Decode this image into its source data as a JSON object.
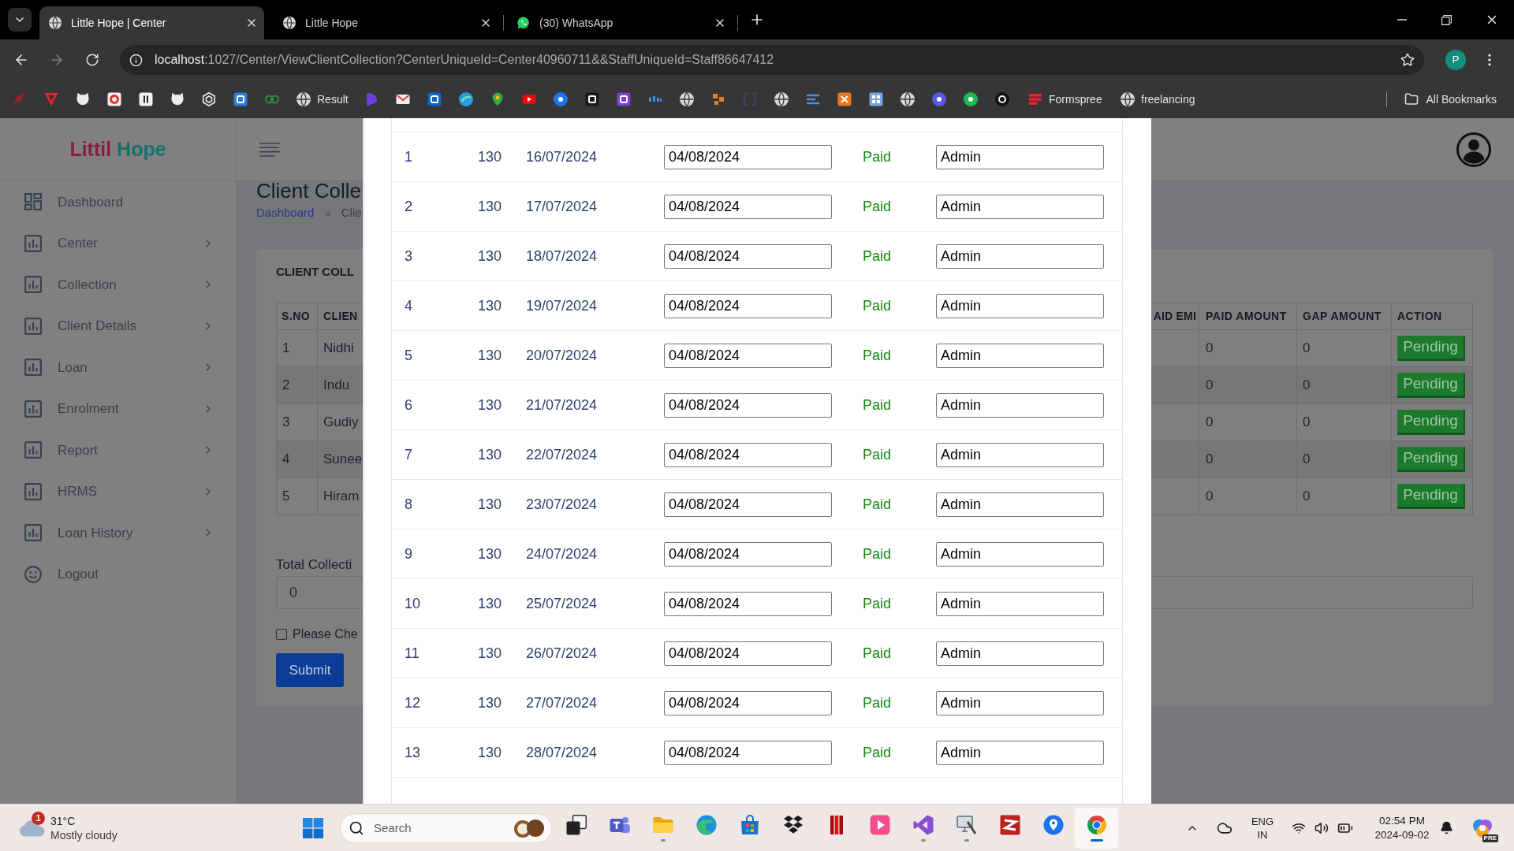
{
  "browser": {
    "tabs": [
      {
        "title": "Little Hope | Center",
        "kind": "site",
        "selected": true
      },
      {
        "title": "Little Hope",
        "kind": "site",
        "selected": false
      },
      {
        "title": "(30) WhatsApp",
        "kind": "chat",
        "selected": false
      }
    ],
    "forward_disabled": true,
    "address": {
      "host": "localhost",
      "rest": ":1027/Center/ViewClientCollection?CenterUniqueId=Center40960711&&StaffUniqueId=Staff86647412"
    },
    "profile_initial": "P",
    "bookmarks": [
      {
        "label": "Result"
      },
      {
        "label": "Formspree"
      },
      {
        "label": "freelancing"
      }
    ],
    "all_bookmarks": "All Bookmarks"
  },
  "app": {
    "logo": {
      "first": "Littil",
      "second": "Hope"
    },
    "sidebar": [
      {
        "label": "Dashboard",
        "kind": "dashboard",
        "expandable": false
      },
      {
        "label": "Center",
        "kind": "chart",
        "expandable": true
      },
      {
        "label": "Collection",
        "kind": "chart",
        "expandable": true
      },
      {
        "label": "Client Details",
        "kind": "chart",
        "expandable": true
      },
      {
        "label": "Loan",
        "kind": "chart",
        "expandable": true
      },
      {
        "label": "Enrolment",
        "kind": "chart",
        "expandable": true
      },
      {
        "label": "Report",
        "kind": "chart",
        "expandable": true
      },
      {
        "label": "HRMS",
        "kind": "chart",
        "expandable": true
      },
      {
        "label": "Loan History",
        "kind": "chart",
        "expandable": true
      },
      {
        "label": "Logout",
        "kind": "logout",
        "expandable": false
      }
    ],
    "page_title": "Client Colle",
    "breadcrumb": [
      {
        "label": "Dashboard",
        "kind": "link"
      },
      {
        "label": "»",
        "kind": "separator"
      },
      {
        "label": "Clie",
        "kind": "current"
      }
    ],
    "card_title": "CLIENT COLL",
    "table": {
      "columns": [
        "S.NO",
        "CLIEN",
        "AID EMI",
        "PAID AMOUNT",
        "GAP AMOUNT",
        "ACTION"
      ],
      "rows": [
        {
          "sno": "1",
          "client": "Nidhi",
          "paid_amount": "0",
          "gap_amount": "0",
          "action": "Pending"
        },
        {
          "sno": "2",
          "client": "Indu",
          "paid_amount": "0",
          "gap_amount": "0",
          "action": "Pending"
        },
        {
          "sno": "3",
          "client": "Gudiy",
          "paid_amount": "0",
          "gap_amount": "0",
          "action": "Pending"
        },
        {
          "sno": "4",
          "client": "Sunee",
          "paid_amount": "0",
          "gap_amount": "0",
          "action": "Pending"
        },
        {
          "sno": "5",
          "client": "Hiram",
          "paid_amount": "0",
          "gap_amount": "0",
          "action": "Pending"
        }
      ]
    },
    "total": {
      "label": "Total Collecti",
      "value": "0"
    },
    "confirm": {
      "label": "Please Che",
      "checked": false
    },
    "submit": "Submit"
  },
  "modal": {
    "rows": [
      {
        "sno": "1",
        "amount": "130",
        "due_date": "16/07/2024",
        "paid_date": "04/08/2024",
        "status": "Paid",
        "collected_by": "Admin"
      },
      {
        "sno": "2",
        "amount": "130",
        "due_date": "17/07/2024",
        "paid_date": "04/08/2024",
        "status": "Paid",
        "collected_by": "Admin"
      },
      {
        "sno": "3",
        "amount": "130",
        "due_date": "18/07/2024",
        "paid_date": "04/08/2024",
        "status": "Paid",
        "collected_by": "Admin"
      },
      {
        "sno": "4",
        "amount": "130",
        "due_date": "19/07/2024",
        "paid_date": "04/08/2024",
        "status": "Paid",
        "collected_by": "Admin"
      },
      {
        "sno": "5",
        "amount": "130",
        "due_date": "20/07/2024",
        "paid_date": "04/08/2024",
        "status": "Paid",
        "collected_by": "Admin"
      },
      {
        "sno": "6",
        "amount": "130",
        "due_date": "21/07/2024",
        "paid_date": "04/08/2024",
        "status": "Paid",
        "collected_by": "Admin"
      },
      {
        "sno": "7",
        "amount": "130",
        "due_date": "22/07/2024",
        "paid_date": "04/08/2024",
        "status": "Paid",
        "collected_by": "Admin"
      },
      {
        "sno": "8",
        "amount": "130",
        "due_date": "23/07/2024",
        "paid_date": "04/08/2024",
        "status": "Paid",
        "collected_by": "Admin"
      },
      {
        "sno": "9",
        "amount": "130",
        "due_date": "24/07/2024",
        "paid_date": "04/08/2024",
        "status": "Paid",
        "collected_by": "Admin"
      },
      {
        "sno": "10",
        "amount": "130",
        "due_date": "25/07/2024",
        "paid_date": "04/08/2024",
        "status": "Paid",
        "collected_by": "Admin"
      },
      {
        "sno": "11",
        "amount": "130",
        "due_date": "26/07/2024",
        "paid_date": "04/08/2024",
        "status": "Paid",
        "collected_by": "Admin"
      },
      {
        "sno": "12",
        "amount": "130",
        "due_date": "27/07/2024",
        "paid_date": "04/08/2024",
        "status": "Paid",
        "collected_by": "Admin"
      },
      {
        "sno": "13",
        "amount": "130",
        "due_date": "28/07/2024",
        "paid_date": "04/08/2024",
        "status": "Paid",
        "collected_by": "Admin"
      }
    ]
  },
  "taskbar": {
    "weather": {
      "badge": "1",
      "temperature": "31°C",
      "condition": "Mostly cloudy"
    },
    "search": {
      "placeholder": "Search"
    },
    "apps": [
      {
        "running": false,
        "active": false
      },
      {
        "running": false,
        "active": false
      },
      {
        "running": true,
        "active": false
      },
      {
        "running": false,
        "active": false
      },
      {
        "running": false,
        "active": false
      },
      {
        "running": false,
        "active": false
      },
      {
        "running": false,
        "active": false
      },
      {
        "running": false,
        "active": false
      },
      {
        "running": true,
        "active": false
      },
      {
        "running": true,
        "active": false
      },
      {
        "running": false,
        "active": false
      },
      {
        "running": false,
        "active": false
      },
      {
        "running": true,
        "active": true
      }
    ],
    "language": {
      "code": "ENG",
      "region": "IN"
    },
    "time": "02:54 PM",
    "date": "2024-09-02",
    "copilot_badge": "PRE"
  }
}
